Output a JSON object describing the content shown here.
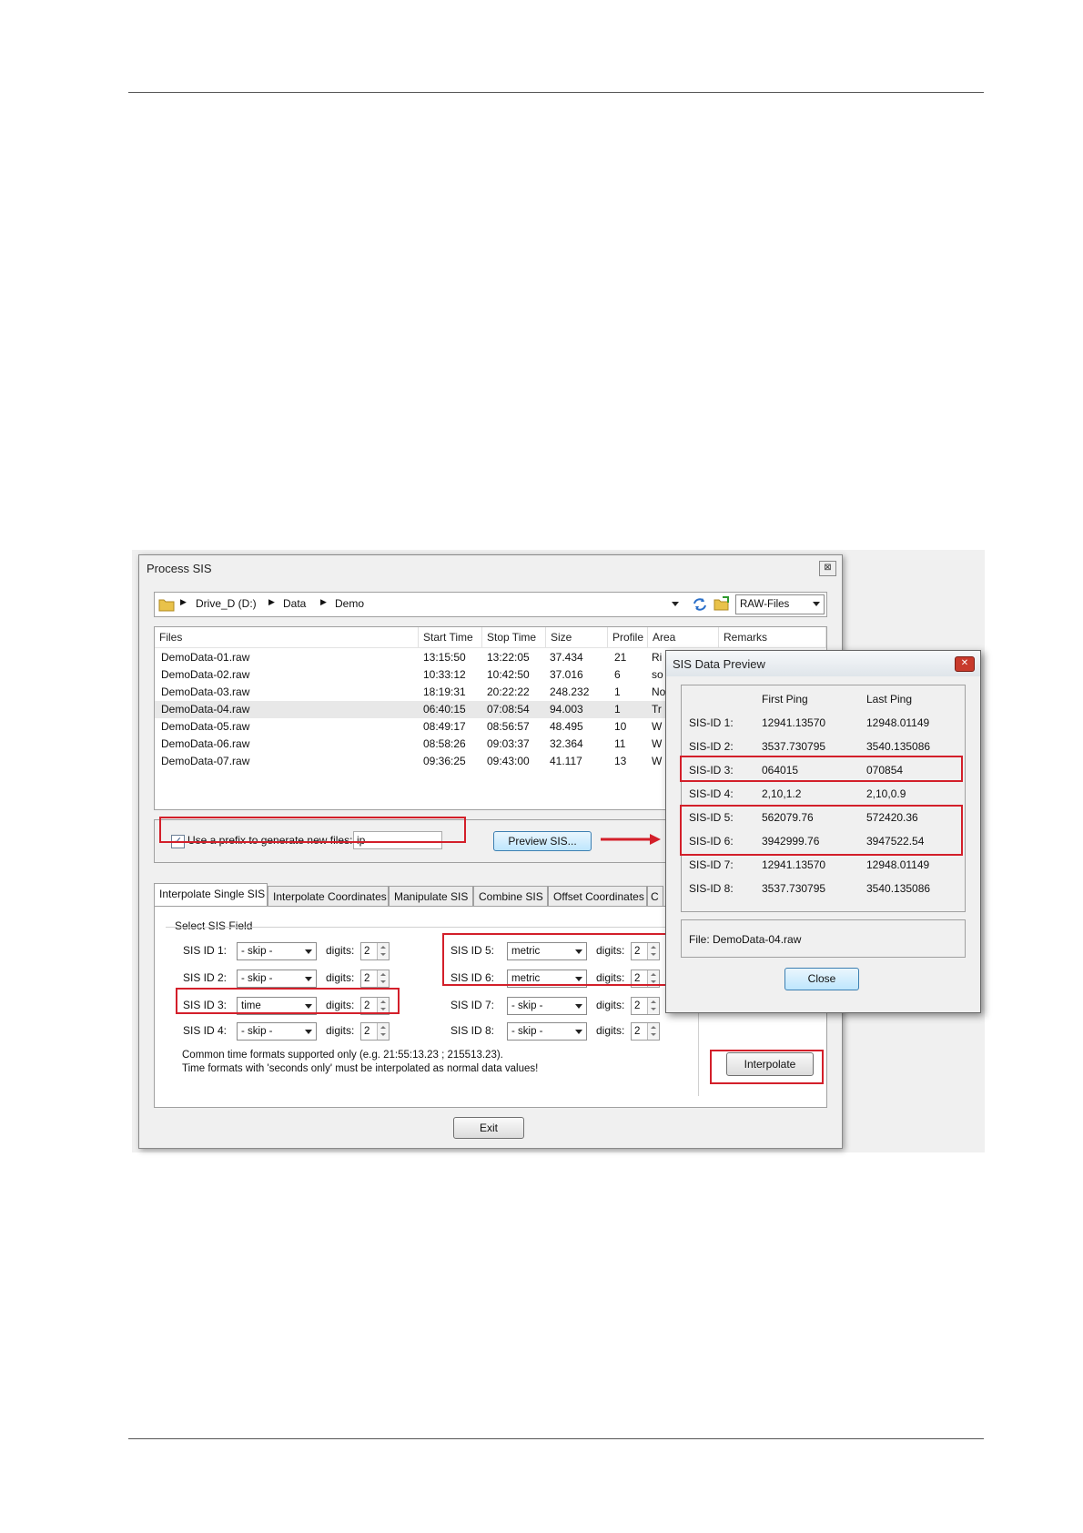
{
  "process_window": {
    "title": "Process SIS",
    "close_glyph": "⊠",
    "breadcrumb": [
      "Drive_D (D:)",
      "Data",
      "Demo"
    ],
    "filter_value": "RAW-Files",
    "columns": [
      "Files",
      "Start Time",
      "Stop Time",
      "Size",
      "Profile",
      "Area",
      "Remarks"
    ],
    "files": [
      {
        "name": "DemoData-01.raw",
        "start": "13:15:50",
        "stop": "13:22:05",
        "size": "37.434",
        "profile": "21",
        "area": "Ri"
      },
      {
        "name": "DemoData-02.raw",
        "start": "10:33:12",
        "stop": "10:42:50",
        "size": "37.016",
        "profile": "6",
        "area": "so"
      },
      {
        "name": "DemoData-03.raw",
        "start": "18:19:31",
        "stop": "20:22:22",
        "size": "248.232",
        "profile": "1",
        "area": "No"
      },
      {
        "name": "DemoData-04.raw",
        "start": "06:40:15",
        "stop": "07:08:54",
        "size": "94.003",
        "profile": "1",
        "area": "Tr"
      },
      {
        "name": "DemoData-05.raw",
        "start": "08:49:17",
        "stop": "08:56:57",
        "size": "48.495",
        "profile": "10",
        "area": "W"
      },
      {
        "name": "DemoData-06.raw",
        "start": "08:58:26",
        "stop": "09:03:37",
        "size": "32.364",
        "profile": "11",
        "area": "W"
      },
      {
        "name": "DemoData-07.raw",
        "start": "09:36:25",
        "stop": "09:43:00",
        "size": "41.117",
        "profile": "13",
        "area": "W"
      }
    ],
    "prefix_label": "Use a prefix to generate new files:",
    "prefix_value": "ip",
    "preview_button": "Preview SIS...",
    "tabs": [
      "Interpolate Single SIS",
      "Interpolate Coordinates",
      "Manipulate SIS",
      "Combine SIS",
      "Offset Coordinates",
      "C"
    ],
    "group_label": "Select SIS Field",
    "digits_label": "digits:",
    "fields_left": [
      {
        "label": "SIS ID 1:",
        "value": "- skip -",
        "digits": "2"
      },
      {
        "label": "SIS ID 2:",
        "value": "- skip -",
        "digits": "2"
      },
      {
        "label": "SIS ID 3:",
        "value": "time",
        "digits": "2"
      },
      {
        "label": "SIS ID 4:",
        "value": "- skip -",
        "digits": "2"
      }
    ],
    "fields_right": [
      {
        "label": "SIS ID 5:",
        "value": "metric",
        "digits": "2"
      },
      {
        "label": "SIS ID 6:",
        "value": "metric",
        "digits": "2"
      },
      {
        "label": "SIS ID 7:",
        "value": "- skip -",
        "digits": "2"
      },
      {
        "label": "SIS ID 8:",
        "value": "- skip -",
        "digits": "2"
      }
    ],
    "note_line1": "Common time formats supported only (e.g. 21:55:13.23 ; 215513.23).",
    "note_line2": "Time formats with 'seconds only' must be interpolated as normal data values!",
    "interpolate_button": "Interpolate",
    "exit_button": "Exit"
  },
  "preview_dialog": {
    "title": "SIS Data Preview",
    "close_glyph": "✕",
    "col_first": "First Ping",
    "col_last": "Last Ping",
    "rows": [
      {
        "id": "SIS-ID 1:",
        "first": "12941.13570",
        "last": "12948.01149"
      },
      {
        "id": "SIS-ID 2:",
        "first": "3537.730795",
        "last": "3540.135086"
      },
      {
        "id": "SIS-ID 3:",
        "first": "064015",
        "last": "070854"
      },
      {
        "id": "SIS-ID 4:",
        "first": "2,10,1.2",
        "last": "2,10,0.9"
      },
      {
        "id": "SIS-ID 5:",
        "first": "562079.76",
        "last": "572420.36"
      },
      {
        "id": "SIS-ID 6:",
        "first": "3942999.76",
        "last": "3947522.54"
      },
      {
        "id": "SIS-ID 7:",
        "first": "12941.13570",
        "last": "12948.01149"
      },
      {
        "id": "SIS-ID 8:",
        "first": "3537.730795",
        "last": "3540.135086"
      }
    ],
    "file_label": "File: DemoData-04.raw",
    "close_button": "Close"
  },
  "colors": {
    "highlight": "#d31f2a",
    "titlebar_close": "#c83a2c"
  },
  "icons": [
    "folder-icon",
    "refresh-icon",
    "open-folder-icon",
    "arrow-right-icon"
  ]
}
